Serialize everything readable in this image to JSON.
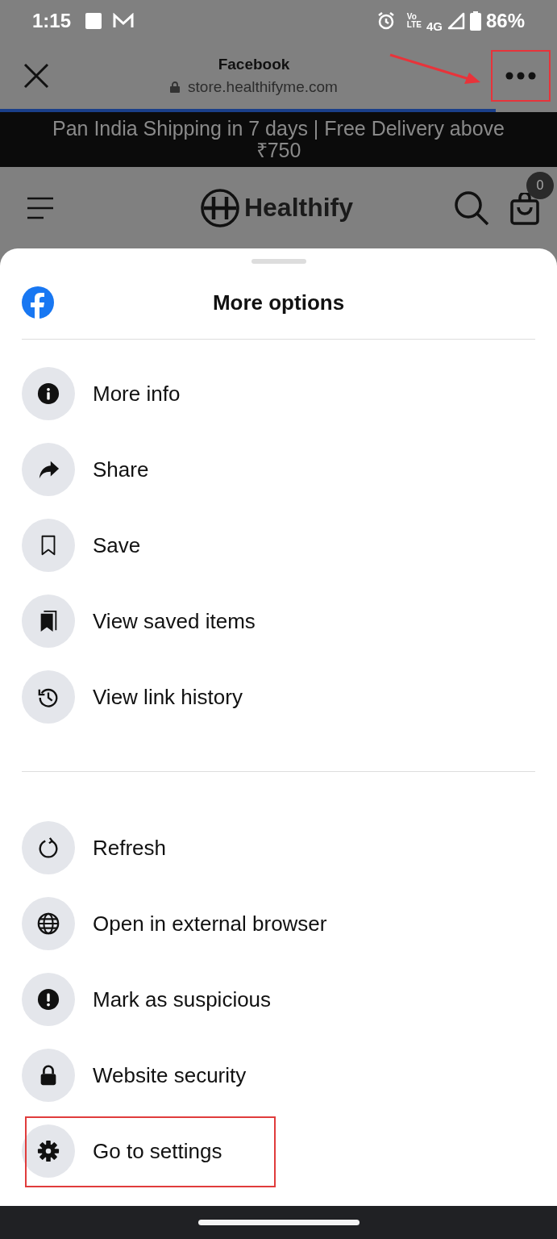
{
  "status_bar": {
    "time": "1:15",
    "volte_top": "Vo",
    "volte_bottom": "LTE",
    "network": "4G",
    "battery": "86%"
  },
  "browser_bar": {
    "title": "Facebook",
    "url": "store.healthifyme.com",
    "progress": {
      "level": 0.89
    },
    "menu_highlighted": true
  },
  "banner": {
    "text": "Pan India Shipping in 7 days | Free Delivery above ₹750"
  },
  "site_header": {
    "logo": "Healthify",
    "cart_count": "0"
  },
  "sheet": {
    "title": "More options",
    "groups": [
      {
        "items": [
          {
            "label": "More info",
            "kind": "info",
            "highlighted": false
          },
          {
            "label": "Share",
            "kind": "share",
            "highlighted": false
          },
          {
            "label": "Save",
            "kind": "bookmark",
            "highlighted": false
          },
          {
            "label": "View saved items",
            "kind": "bookmarks",
            "highlighted": false
          },
          {
            "label": "View link history",
            "kind": "history",
            "highlighted": false
          }
        ]
      },
      {
        "items": [
          {
            "label": "Refresh",
            "kind": "refresh",
            "highlighted": false
          },
          {
            "label": "Open in external browser",
            "kind": "globe",
            "highlighted": false
          },
          {
            "label": "Mark as suspicious",
            "kind": "alert",
            "highlighted": false
          },
          {
            "label": "Website security",
            "kind": "lock",
            "highlighted": false
          },
          {
            "label": "Go to settings",
            "kind": "gear",
            "highlighted": true
          }
        ]
      }
    ]
  }
}
